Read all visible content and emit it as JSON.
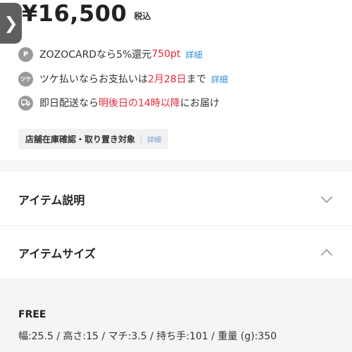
{
  "nav": {
    "back_glyph": "❯",
    "back_icon": "chevron-right-icon"
  },
  "price": {
    "amount": "¥16,500",
    "tax_label": "税込"
  },
  "benefits": [
    {
      "icon": "zozo-card-icon",
      "icon_text": "P",
      "before": "ZOZOCARDなら5%還元 ",
      "highlight": "750pt",
      "after": "",
      "link": "詳細"
    },
    {
      "icon": "tsuke-pay-icon",
      "icon_text": "ツケ",
      "before": "ツケ払いならお支払いは",
      "highlight": "2月28日",
      "after": "まで",
      "link": "詳細"
    },
    {
      "icon": "delivery-truck-icon",
      "icon_text": "",
      "before": "即日配送なら",
      "highlight": "明後日の14時以降",
      "after": "にお届け",
      "link": ""
    }
  ],
  "store_stock": {
    "label": "店舗在庫確認・取り置き対象",
    "link": "詳細"
  },
  "sections": [
    {
      "title": "アイテム説明",
      "expanded": false
    },
    {
      "title": "アイテムサイズ",
      "expanded": true
    }
  ],
  "size_info": {
    "size": "FREE",
    "dimensions": "幅:25.5 / 高さ:15 / マチ:3.5 / 持ち手:101 / 重量 (g):350"
  },
  "colors": {
    "highlight": "#e8283c",
    "link": "#2f8fd8",
    "icon_bg": "#9a9a9a"
  }
}
